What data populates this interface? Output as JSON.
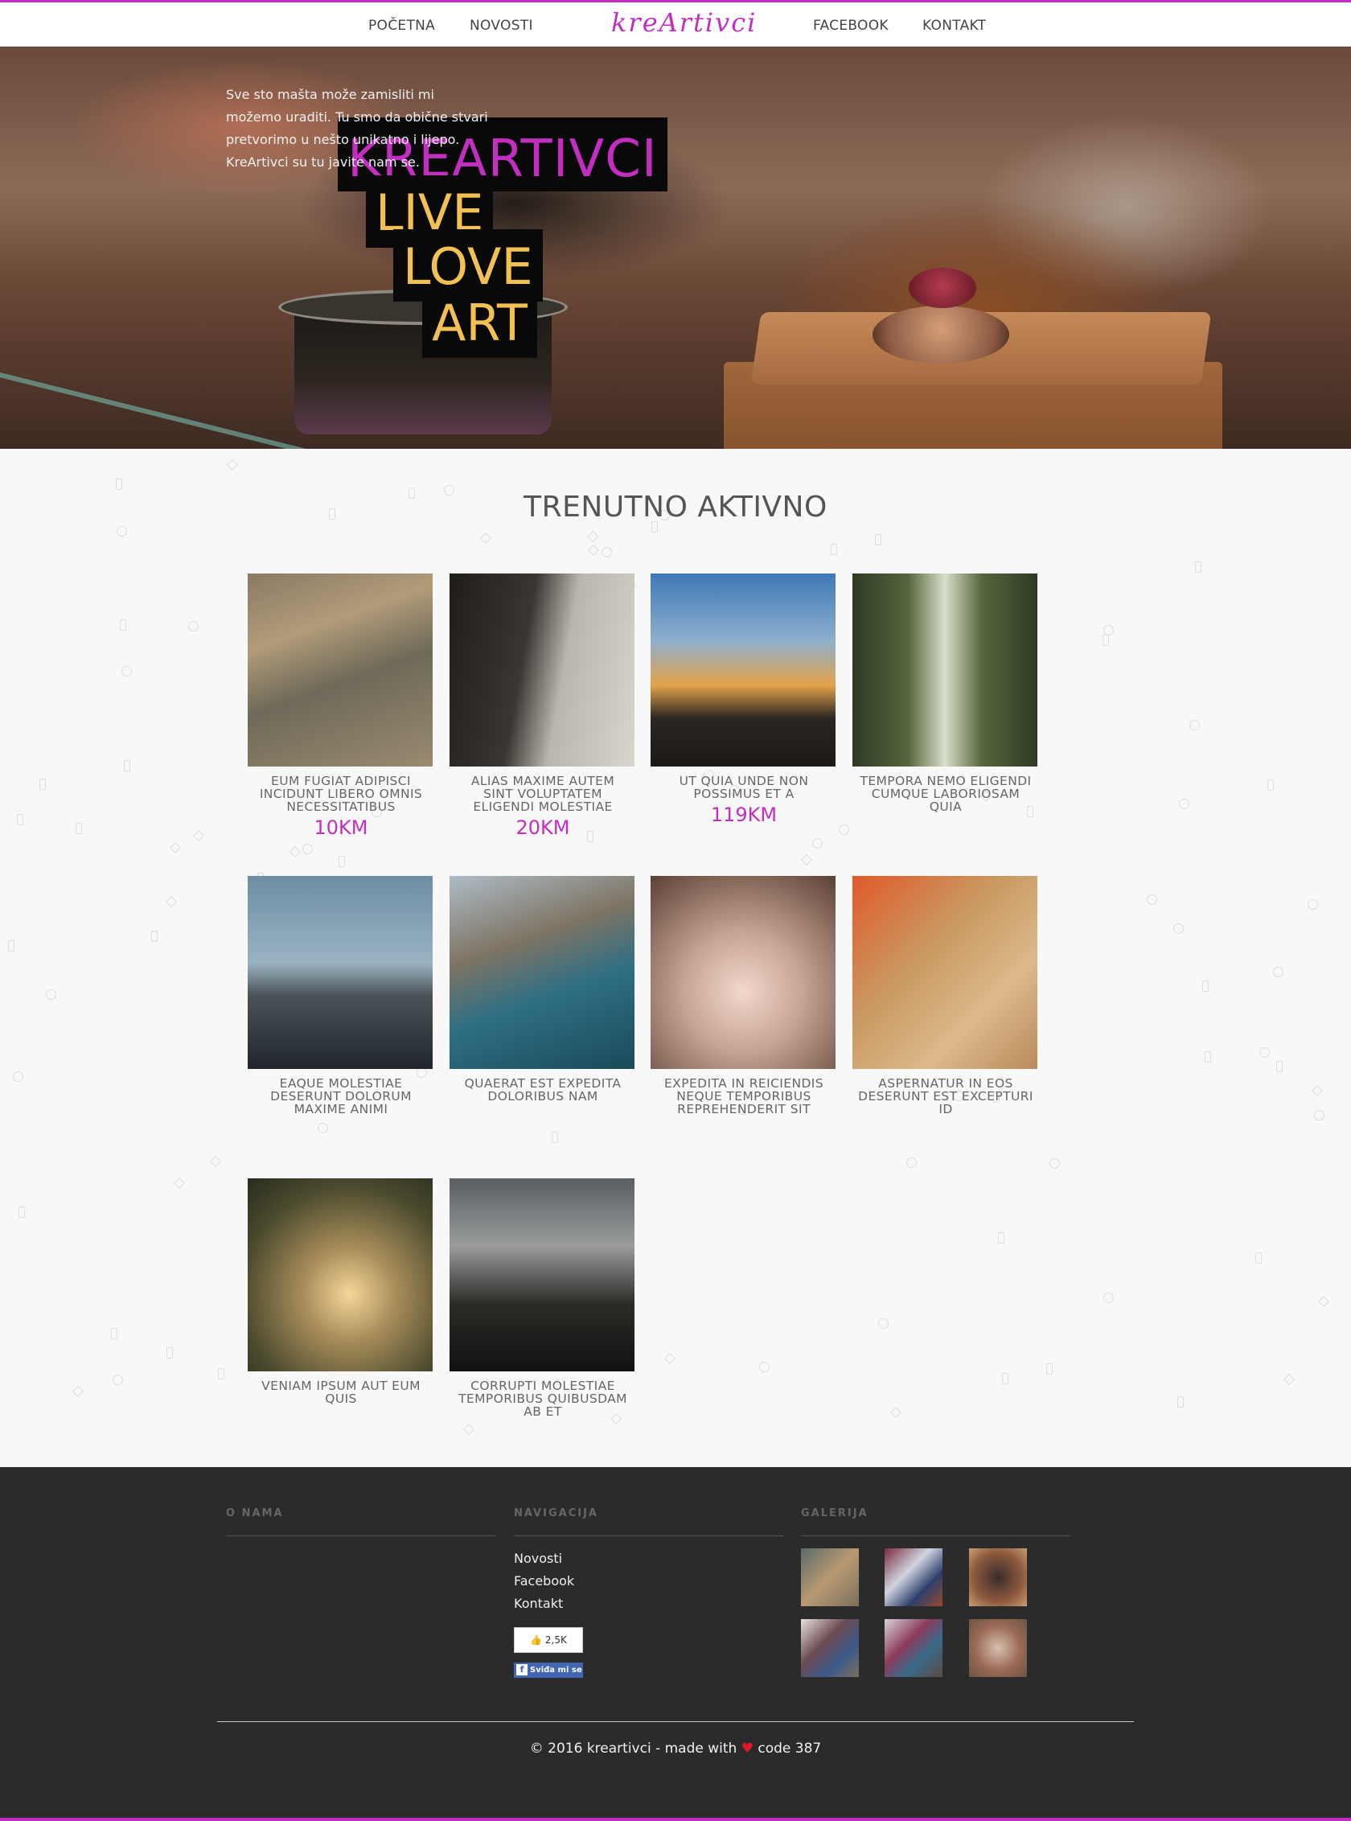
{
  "nav": {
    "left": [
      "POČETNA",
      "NOVOSTI"
    ],
    "logo": "kreArtivci",
    "right": [
      "FACEBOOK",
      "KONTAKT"
    ]
  },
  "hero": {
    "title": "KREARTIVCI",
    "lines": [
      "LIVE",
      "LOVE",
      "ART"
    ]
  },
  "section_title": "TRENUTNO AKTIVNO",
  "products": [
    {
      "title": "EUM FUGIAT ADIPISCI INCIDUNT LIBERO OMNIS NECESSITATIBUS",
      "price": "10KM"
    },
    {
      "title": "ALIAS MAXIME AUTEM SINT VOLUPTATEM ELIGENDI MOLESTIAE",
      "price": "20KM"
    },
    {
      "title": "UT QUIA UNDE NON POSSIMUS ET A",
      "price": "119KM"
    },
    {
      "title": "TEMPORA NEMO ELIGENDI CUMQUE LABORIOSAM QUIA",
      "price": ""
    },
    {
      "title": "EAQUE MOLESTIAE DESERUNT DOLORUM MAXIME ANIMI",
      "price": ""
    },
    {
      "title": "QUAERAT EST EXPEDITA DOLORIBUS NAM",
      "price": ""
    },
    {
      "title": "EXPEDITA IN REICIENDIS NEQUE TEMPORIBUS REPREHENDERIT SIT",
      "price": ""
    },
    {
      "title": "ASPERNATUR IN EOS DESERUNT EST EXCEPTURI ID",
      "price": ""
    },
    {
      "title": "VENIAM IPSUM AUT EUM QUIS",
      "price": ""
    },
    {
      "title": "CORRUPTI MOLESTIAE TEMPORIBUS QUIBUSDAM AB ET",
      "price": ""
    }
  ],
  "footer": {
    "about_heading": "O NAMA",
    "about_text": "Sve sto mašta može zamisliti mi možemo uraditi. Tu smo da obične stvari pretvorimo u nešto unikatno i lijepo. KreArtivci su tu javite nam se.",
    "nav_heading": "NAVIGACIJA",
    "nav_links": [
      "Novosti",
      "Facebook",
      "Kontakt"
    ],
    "like_count": "2,5K",
    "like_label": "Sviđa mi se",
    "gallery_heading": "GALERIJA",
    "copyright_pre": "© 2016 kreartivci - made with",
    "copyright_post": "code 387"
  },
  "colors": {
    "accent": "#c22fc0",
    "hero_yellow": "#f3c054",
    "footer_bg": "#2b2b2b"
  }
}
